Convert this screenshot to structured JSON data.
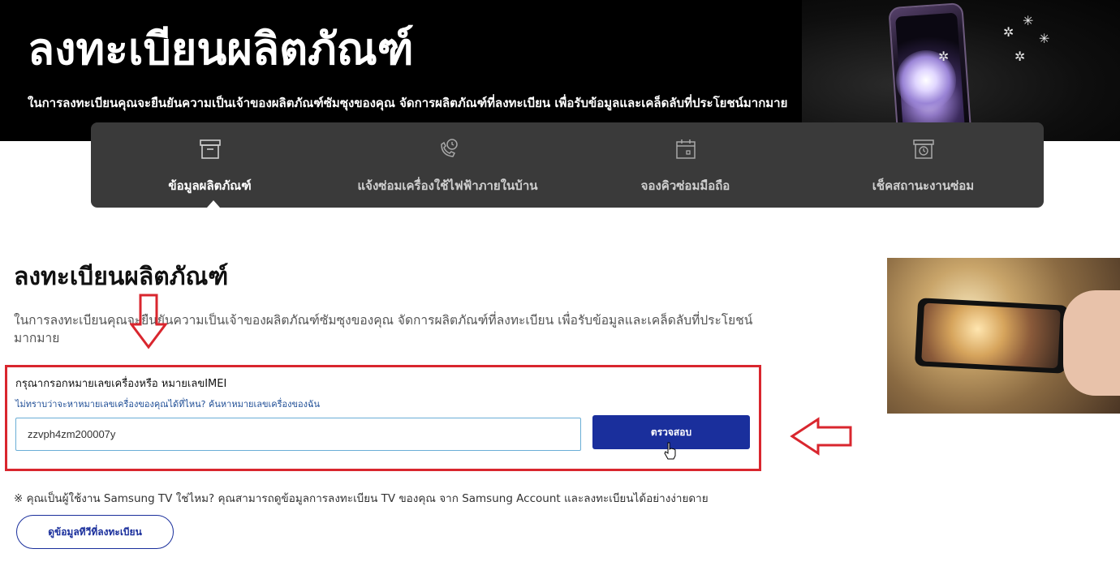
{
  "hero": {
    "title": "ลงทะเบียนผลิตภัณฑ์",
    "subtitle": "ในการลงทะเบียนคุณจะยืนยันความเป็นเจ้าของผลิตภัณฑ์ซัมซุงของคุณ จัดการผลิตภัณฑ์ที่ลงทะเบียน เพื่อรับข้อมูลและเคล็ดลับที่ประโยชน์มากมาย"
  },
  "nav": {
    "items": [
      {
        "label": "ข้อมูลผลิตภัณฑ์",
        "icon": "box-icon",
        "active": true
      },
      {
        "label": "แจ้งซ่อมเครื่องใช้ไฟฟ้าภายในบ้าน",
        "icon": "phone-clock-icon",
        "active": false
      },
      {
        "label": "จองคิวซ่อมมือถือ",
        "icon": "calendar-icon",
        "active": false
      },
      {
        "label": "เช็คสถานะงานซ่อม",
        "icon": "status-clock-icon",
        "active": false
      }
    ]
  },
  "main": {
    "title": "ลงทะเบียนผลิตภัณฑ์",
    "description": "ในการลงทะเบียนคุณจะยืนยันความเป็นเจ้าของผลิตภัณฑ์ซัมซุงของคุณ จัดการผลิตภัณฑ์ที่ลงทะเบียน เพื่อรับข้อมูลและเคล็ดลับที่ประโยชน์มากมาย"
  },
  "form": {
    "label": "กรุณากรอกหมายเลขเครื่องหรือ หมายเลขIMEI",
    "help_link": "ไม่ทราบว่าจะหาหมายเลขเครื่องของคุณได้ที่ไหน? ค้นหาหมายเลขเครื่องของฉัน",
    "input_value": "zzvph4zm200007y",
    "submit_label": "ตรวจสอบ"
  },
  "tv": {
    "note": "※ คุณเป็นผู้ใช้งาน Samsung TV ใช่ไหม? คุณสามารถดูข้อมูลการลงทะเบียน TV ของคุณ จาก Samsung Account และลงทะเบียนได้อย่างง่ายดาย",
    "button_label": "ดูข้อมูลทีวีที่ลงทะเบียน"
  },
  "colors": {
    "hero_bg": "#000000",
    "nav_bg": "#3a3a3a",
    "primary_button": "#1a2f9c",
    "annotation_red": "#d9262e",
    "link": "#1f4e96"
  }
}
